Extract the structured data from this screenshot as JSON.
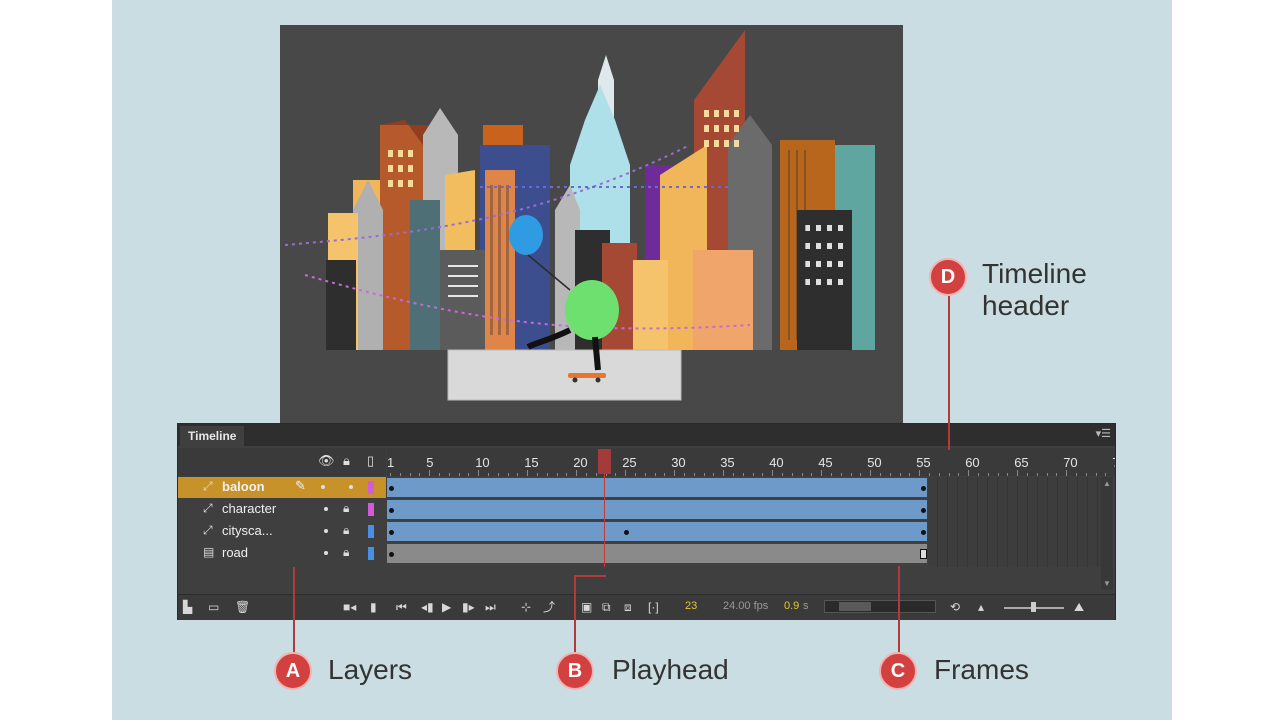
{
  "panel": {
    "title": "Timeline",
    "menu_icon": "panel-menu-icon"
  },
  "ruler": {
    "labels": [
      "1",
      "5",
      "10",
      "15",
      "20",
      "25",
      "30",
      "35",
      "40",
      "45",
      "50",
      "55",
      "60",
      "65",
      "70",
      "7"
    ]
  },
  "layers": [
    {
      "name": "baloon",
      "selected": true,
      "color": "#d45bd8"
    },
    {
      "name": "character",
      "selected": false,
      "color": "#d45bd8"
    },
    {
      "name": "citysca...",
      "selected": false,
      "color": "#4a90e2"
    },
    {
      "name": "road",
      "selected": false,
      "color": "#4a90e2"
    }
  ],
  "status": {
    "current_frame": "23",
    "fps": "24.00 fps",
    "time": "0.9",
    "time_unit": "s"
  },
  "callouts": {
    "a": {
      "letter": "A",
      "label": "Layers"
    },
    "b": {
      "letter": "B",
      "label": "Playhead"
    },
    "c": {
      "letter": "C",
      "label": "Frames"
    },
    "d": {
      "letter": "D",
      "label_line1": "Timeline",
      "label_line2": "header"
    }
  },
  "colors": {
    "selected_layer": "#c8922a",
    "tween_span": "#6e9ac9",
    "playhead": "#c03a3a",
    "callout": "#d2413f"
  }
}
